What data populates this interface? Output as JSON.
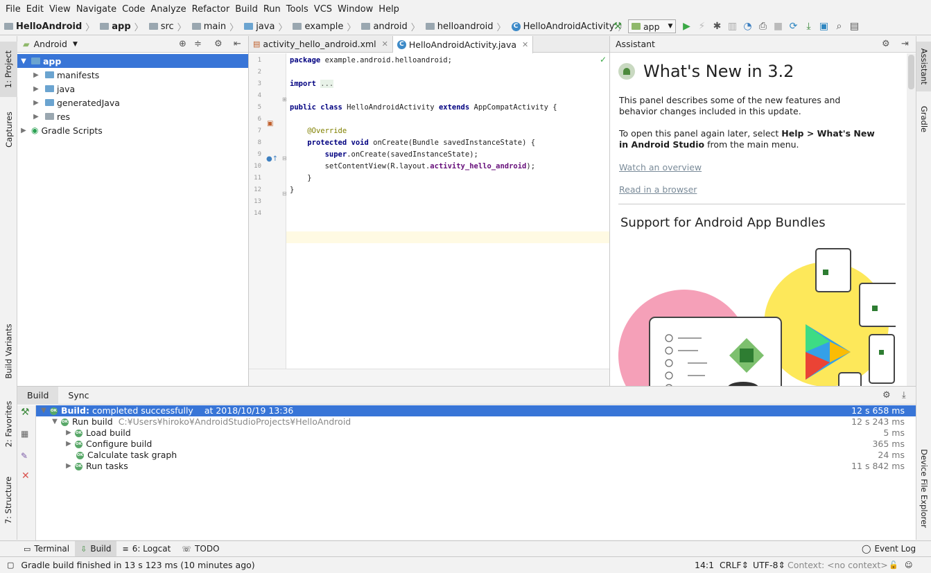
{
  "menu": [
    "File",
    "Edit",
    "View",
    "Navigate",
    "Code",
    "Analyze",
    "Refactor",
    "Build",
    "Run",
    "Tools",
    "VCS",
    "Window",
    "Help"
  ],
  "breadcrumbs": [
    "HelloAndroid",
    "app",
    "src",
    "main",
    "java",
    "example",
    "android",
    "helloandroid",
    "HelloAndroidActivity"
  ],
  "toolbar": {
    "run_config": "app"
  },
  "left_tabs": {
    "project": "1: Project",
    "captures": "Captures",
    "build_variants": "Build Variants",
    "favorites": "2: Favorites",
    "structure": "7: Structure"
  },
  "right_tabs": {
    "assistant": "Assistant",
    "gradle": "Gradle",
    "device_explorer": "Device File Explorer"
  },
  "project": {
    "view": "Android",
    "items": [
      {
        "label": "app",
        "level": 0,
        "expanded": true
      },
      {
        "label": "manifests",
        "level": 1
      },
      {
        "label": "java",
        "level": 1
      },
      {
        "label": "generatedJava",
        "level": 1
      },
      {
        "label": "res",
        "level": 1
      },
      {
        "label": "Gradle Scripts",
        "level": 0
      }
    ]
  },
  "editor": {
    "tabs": [
      {
        "label": "activity_hello_android.xml"
      },
      {
        "label": "HelloAndroidActivity.java",
        "active": true
      }
    ],
    "line_numbers": [
      "1",
      "2",
      "3",
      "4",
      "5",
      "6",
      "7",
      "8",
      "9",
      "10",
      "11",
      "12",
      "13",
      "14"
    ]
  },
  "assistant": {
    "header": "Assistant",
    "title": "What's New in 3.2",
    "p1": "This panel describes some of the new features and behavior changes included in this update.",
    "p2_prefix": "To open this panel again later, select ",
    "p2_bold1": "Help > What's New in Android Studio",
    "p2_suffix": " from the main menu.",
    "link1": "Watch an overview",
    "link2": "Read in a browser",
    "section": "Support for Android App Bundles"
  },
  "build": {
    "tabs": [
      "Build",
      "Sync"
    ],
    "rows": [
      {
        "label": "Build:",
        "label2": "completed successfully",
        "extra": "at 2018/10/19 13:36",
        "duration": "12 s 658 ms"
      },
      {
        "label": "Run build",
        "path": "C:¥Users¥hiroko¥AndroidStudioProjects¥HelloAndroid",
        "duration": "12 s 243 ms"
      },
      {
        "label": "Load build",
        "duration": "5 ms"
      },
      {
        "label": "Configure build",
        "duration": "365 ms"
      },
      {
        "label": "Calculate task graph",
        "duration": "24 ms"
      },
      {
        "label": "Run tasks",
        "duration": "11 s 842 ms"
      }
    ]
  },
  "tool_tabs": [
    "Terminal",
    "Build",
    "6: Logcat",
    "TODO"
  ],
  "event_log": "Event Log",
  "status": {
    "message": "Gradle build finished in 13 s 123 ms (10 minutes ago)",
    "position": "14:1",
    "line_sep": "CRLF",
    "encoding": "UTF-8",
    "context": "Context: <no context>"
  }
}
